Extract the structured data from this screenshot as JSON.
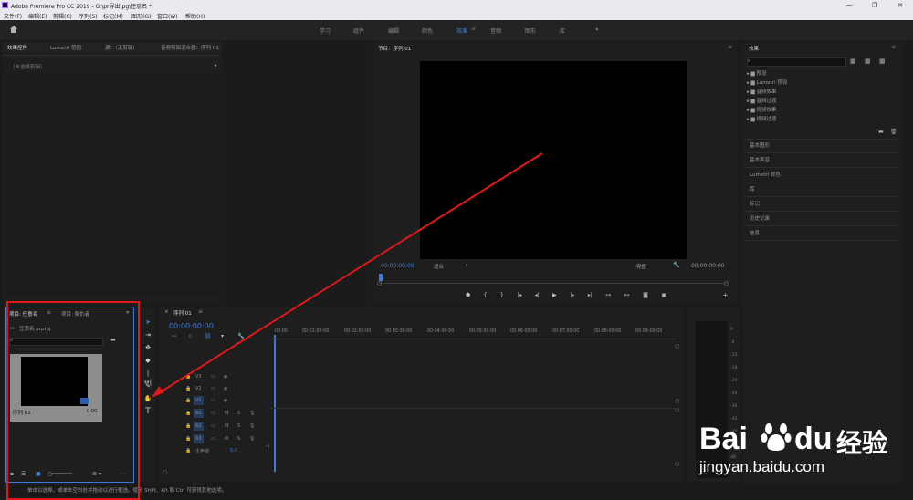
{
  "app": {
    "title": "Adobe Premiere Pro CC 2019 - G:\\pr导出\\pg\\任意名 *",
    "window_controls": [
      "—",
      "❐",
      "✕"
    ]
  },
  "menu": [
    "文件(F)",
    "编辑(E)",
    "剪辑(C)",
    "序列(S)",
    "标记(M)",
    "图形(G)",
    "窗口(W)",
    "帮助(H)"
  ],
  "workspaces": {
    "tabs": [
      "学习",
      "组件",
      "编辑",
      "颜色",
      "效果",
      "音频",
      "图形",
      "库"
    ],
    "active": "效果",
    "more": "»"
  },
  "source_panel": {
    "tabs": [
      "效果控件",
      "Lumetri 范围",
      "源：（无剪辑）",
      "音频剪辑混合器：序列 01"
    ],
    "no_clip": "（未选择剪辑）"
  },
  "program_monitor": {
    "title": "节目：序列 01",
    "timecode": "00:00:00:00",
    "fit": "适合",
    "quality": "完整",
    "end_timecode": "00:00:00:00"
  },
  "effects_panel": {
    "title": "效果",
    "search_placeholder": "",
    "folders": [
      "预设",
      "Lumetri 预设",
      "音频效果",
      "音频过渡",
      "视频效果",
      "视频过渡"
    ],
    "sections": [
      "基本图形",
      "基本声音",
      "Lumetri 颜色",
      "库",
      "标记",
      "历史记录",
      "信息"
    ]
  },
  "project_panel": {
    "tabs": [
      "项目: 任意名",
      "项目: 斐仇者"
    ],
    "project_file": "任意名.prproj",
    "clip_name": "序列 01",
    "clip_duration": "0:00"
  },
  "timeline": {
    "title": "序列 01",
    "timecode": "00:00:00:00",
    "ruler": [
      "00:00",
      "00:01:00:00",
      "00:02:00:00",
      "00:03:00:00",
      "00:04:00:00",
      "00:05:00:00",
      "00:06:00:00",
      "00:07:00:00",
      "00:08:00:00",
      "00:09:00:00"
    ],
    "video_tracks": [
      "V3",
      "V2",
      "V1"
    ],
    "audio_tracks": [
      "A1",
      "A2",
      "A3"
    ],
    "master": "主声道",
    "master_value": "0.0"
  },
  "audio_meter": {
    "scale": [
      "0",
      "-6",
      "-12",
      "-18",
      "-24",
      "-30",
      "-36",
      "-42",
      "-48",
      "-54"
    ],
    "unit": "dB"
  },
  "status_bar": {
    "text": "单击以选择，或单击空白处并拖动以进行框选。使用 Shift、Alt 和 Ctrl 可获得其他选项。"
  },
  "watermark": {
    "brand": "Bai",
    "brand2": "du",
    "site_cn": "经验",
    "url": "jingyan.baidu.com"
  },
  "colors": {
    "accent": "#3d7bd8",
    "highlight_box": "#e01818",
    "arrow": "#e01818"
  }
}
